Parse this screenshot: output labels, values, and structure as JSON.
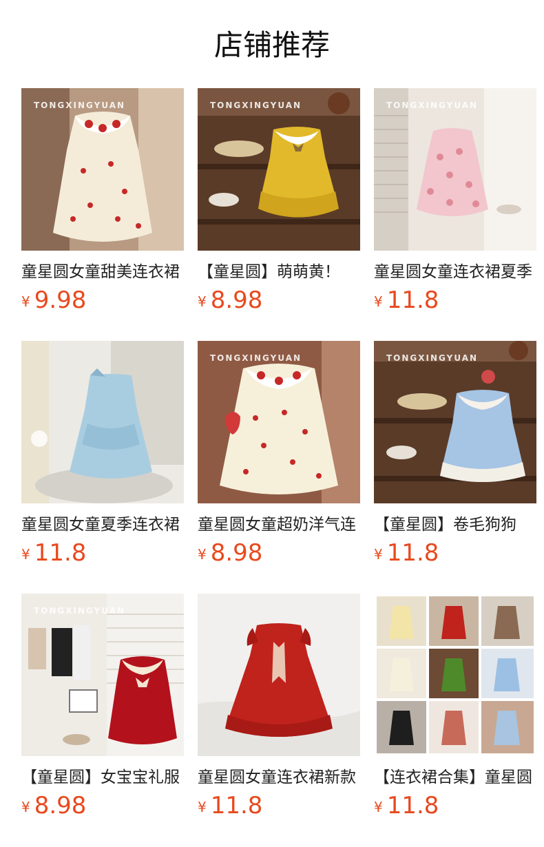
{
  "page": {
    "title": "店铺推荐"
  },
  "products": [
    {
      "title": "童星圆女童甜美连衣裙",
      "currency": "¥",
      "price": "9.98",
      "watermark": "TONGXINGYUAN",
      "image": "cream-cherry-collar-dress"
    },
    {
      "title": "【童星圆】萌萌黄！",
      "currency": "¥",
      "price": "8.98",
      "watermark": "TONGXINGYUAN",
      "image": "yellow-bow-dress"
    },
    {
      "title": "童星圆女童连衣裙夏季",
      "currency": "¥",
      "price": "11.8",
      "watermark": "TONGXINGYUAN",
      "image": "pink-floral-dress"
    },
    {
      "title": "童星圆女童夏季连衣裙",
      "currency": "¥",
      "price": "11.8",
      "watermark": "",
      "image": "light-blue-halter-dress"
    },
    {
      "title": "童星圆女童超奶洋气连",
      "currency": "¥",
      "price": "8.98",
      "watermark": "TONGXINGYUAN",
      "image": "cream-cherry-bubble-dress"
    },
    {
      "title": "【童星圆】卷毛狗狗",
      "currency": "¥",
      "price": "11.8",
      "watermark": "TONGXINGYUAN",
      "image": "blue-gingham-dress"
    },
    {
      "title": "【童星圆】女宝宝礼服",
      "currency": "¥",
      "price": "8.98",
      "watermark": "TONGXINGYUAN",
      "image": "red-strawberry-collar-dress"
    },
    {
      "title": "童星圆女童连衣裙新款",
      "currency": "¥",
      "price": "11.8",
      "watermark": "",
      "image": "red-ruffle-dress"
    },
    {
      "title": "【连衣裙合集】童星圆",
      "currency": "¥",
      "price": "11.8",
      "watermark": "",
      "image": "dress-collection-collage"
    }
  ]
}
